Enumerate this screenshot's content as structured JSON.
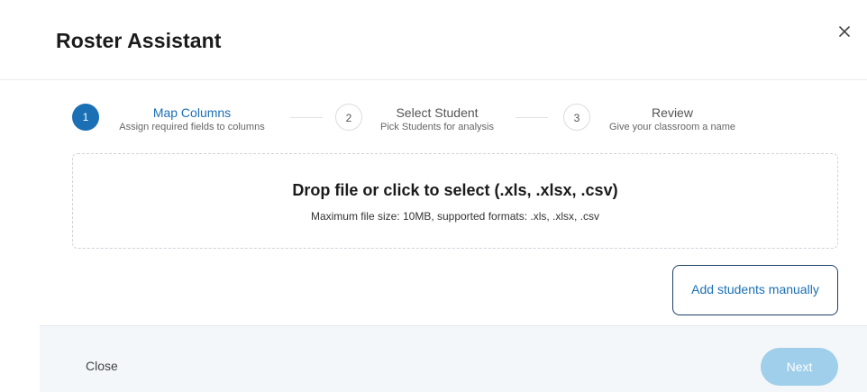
{
  "modal": {
    "title": "Roster Assistant",
    "close_icon": "close-icon"
  },
  "stepper": {
    "steps": [
      {
        "number": "1",
        "title": "Map Columns",
        "subtitle": "Assign required fields to columns",
        "active": true
      },
      {
        "number": "2",
        "title": "Select Student",
        "subtitle": "Pick Students for analysis",
        "active": false
      },
      {
        "number": "3",
        "title": "Review",
        "subtitle": "Give your classroom a name",
        "active": false
      }
    ]
  },
  "dropzone": {
    "title": "Drop file or click to select (.xls, .xlsx, .csv)",
    "subtitle": "Maximum file size: 10MB, supported formats: .xls, .xlsx, .csv"
  },
  "actions": {
    "add_manually_label": "Add students manually"
  },
  "footer": {
    "close_label": "Close",
    "next_label": "Next"
  },
  "colors": {
    "accent": "#1a6fb5",
    "next_disabled": "#9fcfea",
    "footer_bg": "#f4f7f9",
    "button_border": "#1f3f66"
  }
}
